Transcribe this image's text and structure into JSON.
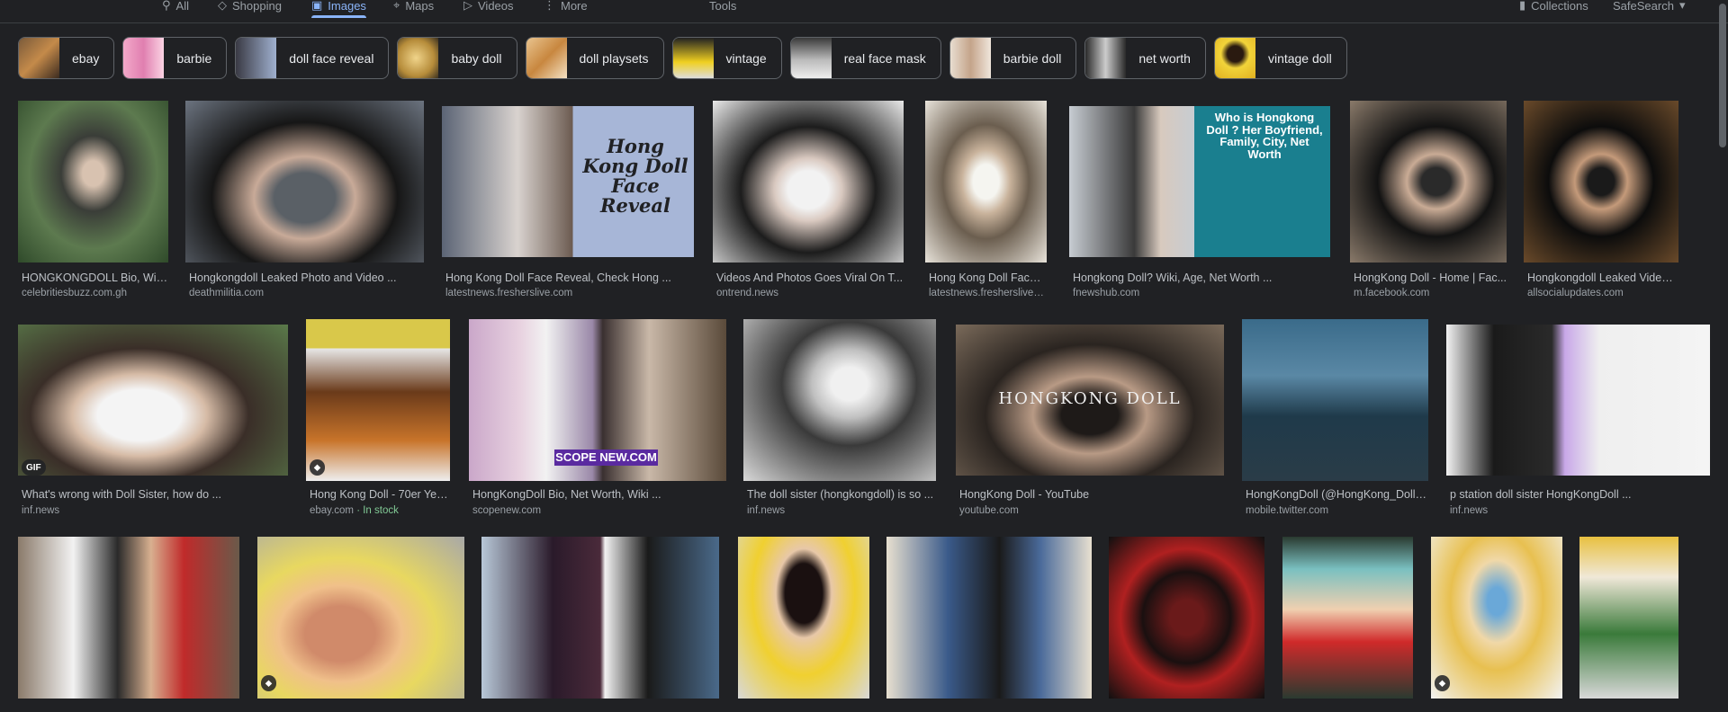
{
  "tabs": {
    "all": "All",
    "shopping": "Shopping",
    "images": "Images",
    "maps": "Maps",
    "videos": "Videos",
    "more": "More",
    "tools": "Tools",
    "collections": "Collections",
    "safesearch": "SafeSearch"
  },
  "chips": [
    {
      "label": "ebay"
    },
    {
      "label": "barbie"
    },
    {
      "label": "doll face reveal"
    },
    {
      "label": "baby doll"
    },
    {
      "label": "doll playsets"
    },
    {
      "label": "vintage"
    },
    {
      "label": "real face mask"
    },
    {
      "label": "barbie doll"
    },
    {
      "label": "net worth"
    },
    {
      "label": "vintage doll"
    }
  ],
  "row1": [
    {
      "title": "HONGKONGDOLL Bio, Wiki,...",
      "source": "celebritiesbuzz.com.gh"
    },
    {
      "title": "Hongkongdoll Leaked Photo and Video ...",
      "source": "deathmilitia.com"
    },
    {
      "title": "Hong Kong Doll Face Reveal, Check Hong ...",
      "source": "latestnews.fresherslive.com",
      "overlay": "Hong Kong Doll Face Reveal"
    },
    {
      "title": "Videos And Photos Goes Viral On T...",
      "source": "ontrend.news"
    },
    {
      "title": "Hong Kong Doll Face R...",
      "source": "latestnews.fresherslive.c..."
    },
    {
      "title": "Hongkong Doll? Wiki, Age, Net Worth ...",
      "source": "fnewshub.com",
      "overlay": "Who is Hongkong Doll ? Her Boyfriend, Family, City, Net Worth"
    },
    {
      "title": "HongKong Doll - Home | Fac...",
      "source": "m.facebook.com"
    },
    {
      "title": "Hongkongdoll Leaked Video Leave...",
      "source": "allsocialupdates.com"
    }
  ],
  "row2": [
    {
      "title": "What's wrong with Doll Sister, how do ...",
      "source": "inf.news",
      "badge": "GIF"
    },
    {
      "title": "Hong Kong Doll - 70er Yea...",
      "source": "ebay.com",
      "stock": " · In stock",
      "badge": "tag"
    },
    {
      "title": "HongKongDoll Bio, Net Worth, Wiki ...",
      "source": "scopenew.com",
      "overlay": "SCOPE NEW.COM"
    },
    {
      "title": "The doll sister (hongkongdoll) is so ...",
      "source": "inf.news"
    },
    {
      "title": "HongKong Doll - YouTube",
      "source": "youtube.com",
      "overlay": "HONGKONG DOLL"
    },
    {
      "title": "HongKongDoll (@HongKong_Doll) ...",
      "source": "mobile.twitter.com"
    },
    {
      "title": "p station doll sister HongKongDoll ...",
      "source": "inf.news"
    }
  ],
  "colors": {
    "background": "#202124",
    "accent": "#8ab4f8",
    "text": "#bdc1c6",
    "stock": "#81c995"
  }
}
